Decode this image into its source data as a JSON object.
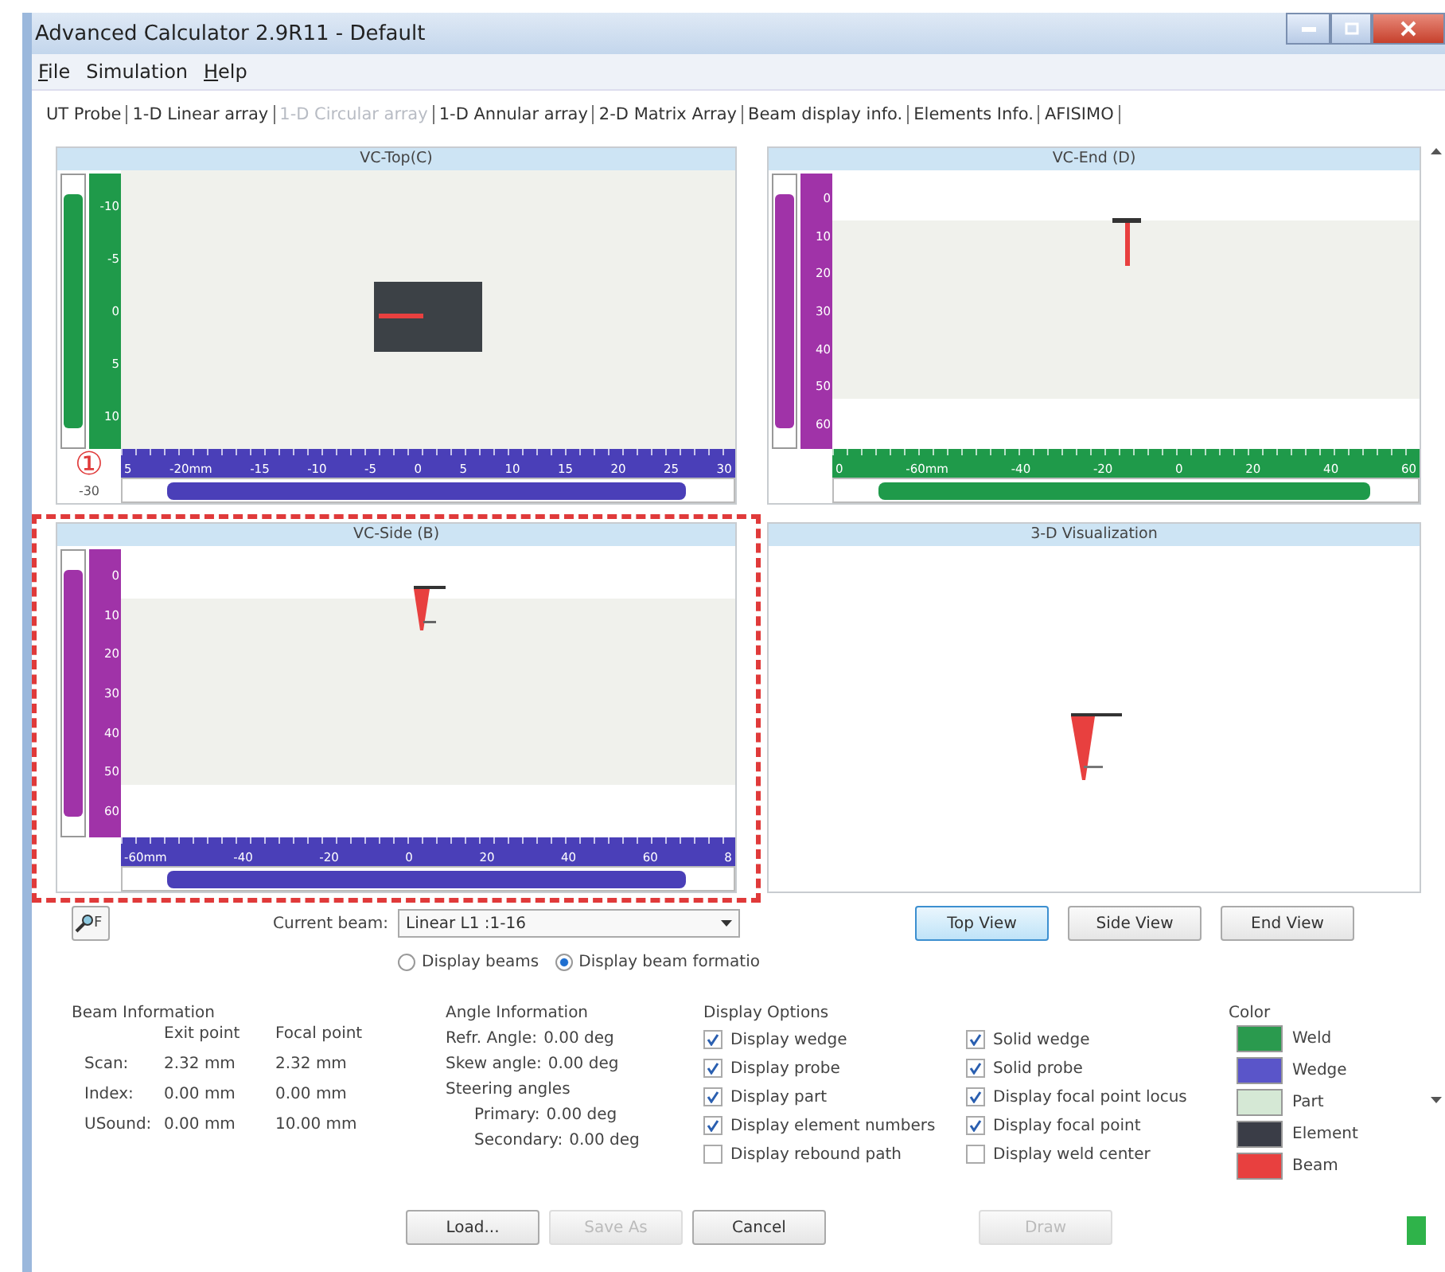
{
  "window": {
    "title": "Advanced Calculator 2.9R11 - Default"
  },
  "menu": [
    {
      "label": "File",
      "underlined": true
    },
    {
      "label": "Simulation",
      "underlined": false
    },
    {
      "label": "Help",
      "underlined": true
    }
  ],
  "tabs": [
    {
      "label": "UT Probe",
      "disabled": false
    },
    {
      "label": "1-D Linear array",
      "disabled": false
    },
    {
      "label": "1-D Circular array",
      "disabled": true
    },
    {
      "label": "1-D Annular array",
      "disabled": false
    },
    {
      "label": "2-D Matrix Array",
      "disabled": false
    },
    {
      "label": "Beam display info.",
      "disabled": false
    },
    {
      "label": "Elements Info.",
      "disabled": false
    },
    {
      "label": "AFISIMO",
      "disabled": false
    }
  ],
  "views": [
    {
      "title": "VC-Top(C)",
      "kind": "top",
      "highlighted": false,
      "marker": "①",
      "scroll_label": "-30",
      "vertical_ruler": {
        "color": "#1f9a4a",
        "labels": [
          "-10",
          "-5",
          "0",
          "5",
          "10"
        ]
      },
      "horizontal_ruler": {
        "color": "#4a3fb8",
        "labels": [
          "5",
          "-20mm",
          "-15",
          "-10",
          "-5",
          "0",
          "5",
          "10",
          "15",
          "20",
          "25",
          "30"
        ]
      }
    },
    {
      "title": "VC-End (D)",
      "kind": "end",
      "highlighted": false,
      "vertical_ruler": {
        "color": "#a033a8",
        "labels": [
          "0",
          "10",
          "20",
          "30",
          "40",
          "50",
          "60"
        ]
      },
      "horizontal_ruler": {
        "color": "#1f9a4a",
        "labels": [
          "0",
          "-60mm",
          "-40",
          "-20",
          "0",
          "20",
          "40",
          "60"
        ]
      }
    },
    {
      "title": "VC-Side (B)",
      "kind": "side",
      "highlighted": true,
      "vertical_ruler": {
        "color": "#a033a8",
        "labels": [
          "0",
          "10",
          "20",
          "30",
          "40",
          "50",
          "60"
        ]
      },
      "horizontal_ruler": {
        "color": "#4a3fb8",
        "labels": [
          "-60mm",
          "-40",
          "-20",
          "0",
          "20",
          "40",
          "60",
          "8"
        ]
      }
    },
    {
      "title": "3-D Visualization",
      "kind": "perspective",
      "highlighted": false
    }
  ],
  "search_button": {
    "label": "F"
  },
  "beam_selector": {
    "label": "Current beam:",
    "value": "Linear  L1 :1-16"
  },
  "radios": [
    {
      "label": "Display beams",
      "selected": false
    },
    {
      "label": "Display beam formatio",
      "selected": true
    }
  ],
  "view_buttons": [
    {
      "label": "Top View",
      "selected": true
    },
    {
      "label": "Side View",
      "selected": false
    },
    {
      "label": "End View",
      "selected": false
    }
  ],
  "beam_info": {
    "title": "Beam Information",
    "columns": [
      "Exit point",
      "Focal point"
    ],
    "rows": [
      {
        "label": "Scan:",
        "values": [
          "2.32 mm",
          "2.32 mm"
        ]
      },
      {
        "label": "Index:",
        "values": [
          "0.00 mm",
          "0.00 mm"
        ]
      },
      {
        "label": "USound:",
        "values": [
          "0.00 mm",
          "10.00 mm"
        ]
      }
    ]
  },
  "angle_info": {
    "title": "Angle Information",
    "rows": [
      {
        "label": "Refr. Angle:",
        "value": "0.00 deg"
      },
      {
        "label": "Skew angle:",
        "value": "0.00 deg"
      }
    ],
    "steering_title": "Steering angles",
    "steering": [
      {
        "label": "Primary:",
        "value": "0.00 deg"
      },
      {
        "label": "Secondary:",
        "value": "0.00 deg"
      }
    ]
  },
  "display_options": {
    "title": "Display Options",
    "items": [
      {
        "label": "Display wedge",
        "checked": true
      },
      {
        "label": "Display probe",
        "checked": true
      },
      {
        "label": "Display part",
        "checked": true
      },
      {
        "label": "Display element numbers",
        "checked": true
      },
      {
        "label": "Display rebound path",
        "checked": false
      },
      {
        "label": "Solid wedge",
        "checked": true
      },
      {
        "label": "Solid probe",
        "checked": true
      },
      {
        "label": "Display focal point locus",
        "checked": true
      },
      {
        "label": "Display focal point",
        "checked": true
      },
      {
        "label": "Display weld center",
        "checked": false
      }
    ]
  },
  "color_legend": {
    "title": "Color",
    "items": [
      {
        "label": "Weld",
        "color": "#2a9a4e"
      },
      {
        "label": "Wedge",
        "color": "#5a55c9"
      },
      {
        "label": "Part",
        "color": "#d5e8d5"
      },
      {
        "label": "Element",
        "color": "#3a3d47"
      },
      {
        "label": "Beam",
        "color": "#e8403f"
      }
    ]
  },
  "bottom_buttons": [
    {
      "label": "Load...",
      "disabled": false
    },
    {
      "label": "Save As",
      "disabled": true
    },
    {
      "label": "Cancel",
      "disabled": false
    },
    {
      "label": "Draw",
      "disabled": true
    }
  ]
}
